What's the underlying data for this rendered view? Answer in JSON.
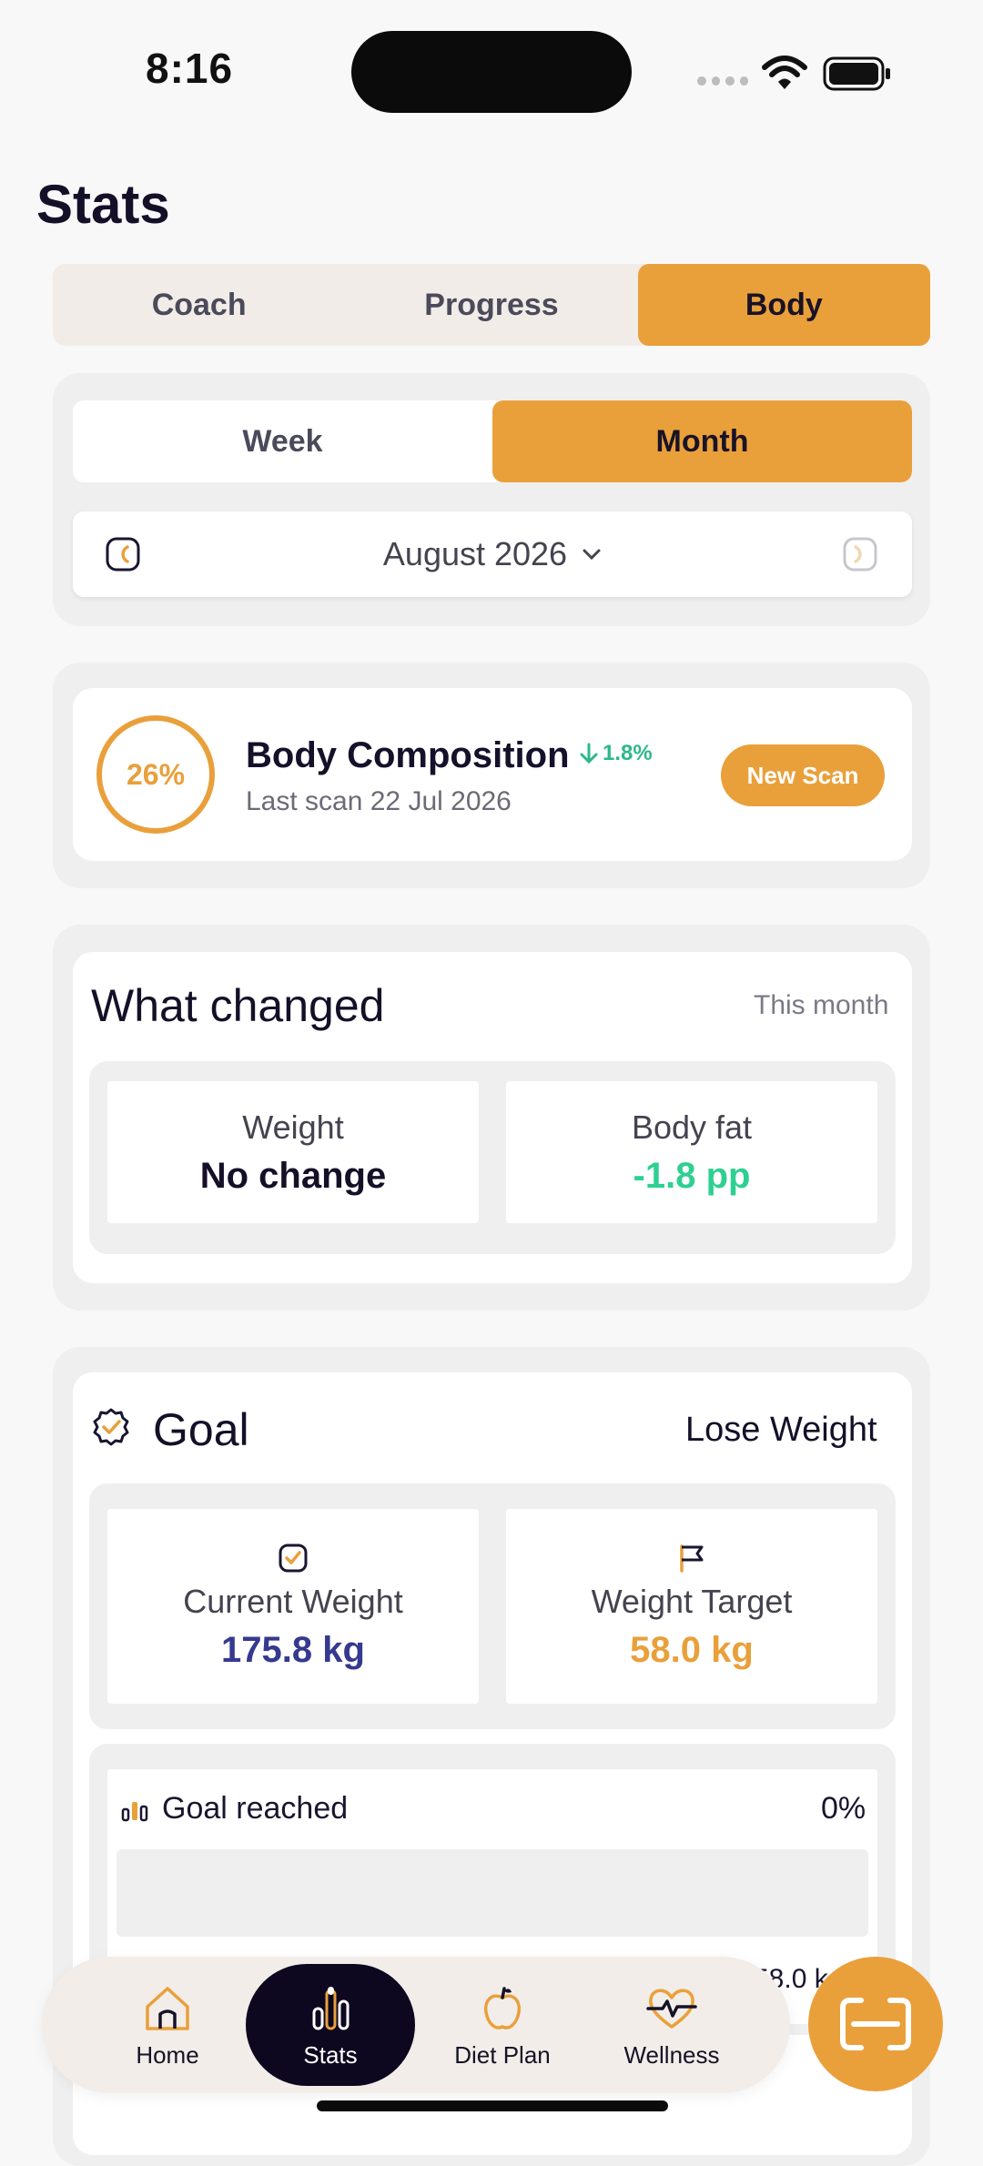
{
  "status_bar": {
    "time": "8:16"
  },
  "page": {
    "title": "Stats"
  },
  "top_tabs": [
    {
      "label": "Coach",
      "active": false
    },
    {
      "label": "Progress",
      "active": false
    },
    {
      "label": "Body",
      "active": true
    }
  ],
  "period": {
    "options": [
      {
        "label": "Week",
        "active": false
      },
      {
        "label": "Month",
        "active": true
      }
    ],
    "month_label": "August 2026"
  },
  "composition": {
    "percent_label": "26%",
    "percent_value": 26,
    "title": "Body Composition",
    "delta": "1.8%",
    "subtitle": "Last scan 22 Jul 2026",
    "button": "New Scan"
  },
  "what_changed": {
    "title": "What changed",
    "period": "This month",
    "weight": {
      "label": "Weight",
      "value": "No change"
    },
    "body_fat": {
      "label": "Body fat",
      "value": "-1.8 pp"
    }
  },
  "goal": {
    "title": "Goal",
    "type": "Lose Weight",
    "current": {
      "label": "Current Weight",
      "value": "175.8 kg"
    },
    "target": {
      "label": "Weight Target",
      "value": "58.0 kg"
    },
    "reached": {
      "label": "Goal reached",
      "percent_label": "0%",
      "progress": 0,
      "end_value": "58.0 kg"
    }
  },
  "bottom_nav": [
    {
      "label": "Home",
      "icon": "home-icon",
      "active": false
    },
    {
      "label": "Stats",
      "icon": "stats-icon",
      "active": true
    },
    {
      "label": "Diet Plan",
      "icon": "apple-icon",
      "active": false
    },
    {
      "label": "Wellness",
      "icon": "heart-pulse-icon",
      "active": false
    }
  ],
  "fab": {
    "icon": "scan-icon"
  },
  "colors": {
    "accent": "#E9A03B",
    "dark": "#0D0720",
    "positive": "#2ED091",
    "navy": "#353A8E"
  }
}
